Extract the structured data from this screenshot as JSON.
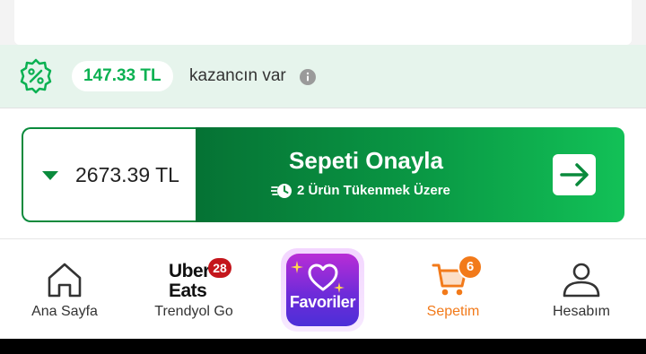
{
  "savings": {
    "amount": "147.33 TL",
    "text": "kazancın var",
    "icon": "discount-badge-icon",
    "info_icon": "info-icon"
  },
  "checkout": {
    "total": "2673.39 TL",
    "confirm_label": "Sepeti Onayla",
    "stock_warning": "2 Ürün Tükenmek Üzere",
    "arrow_icon": "arrow-right-icon",
    "accent_color": "#0a8a3c"
  },
  "nav": {
    "home_label": "Ana Sayfa",
    "go_logo_top": "Uber",
    "go_logo_bottom": "Eats",
    "go_badge": "28",
    "go_label": "Trendyol Go",
    "favorites_label": "Favoriler",
    "cart_label": "Sepetim",
    "cart_count": "6",
    "account_label": "Hesabım",
    "active_color": "#f27a1a"
  }
}
